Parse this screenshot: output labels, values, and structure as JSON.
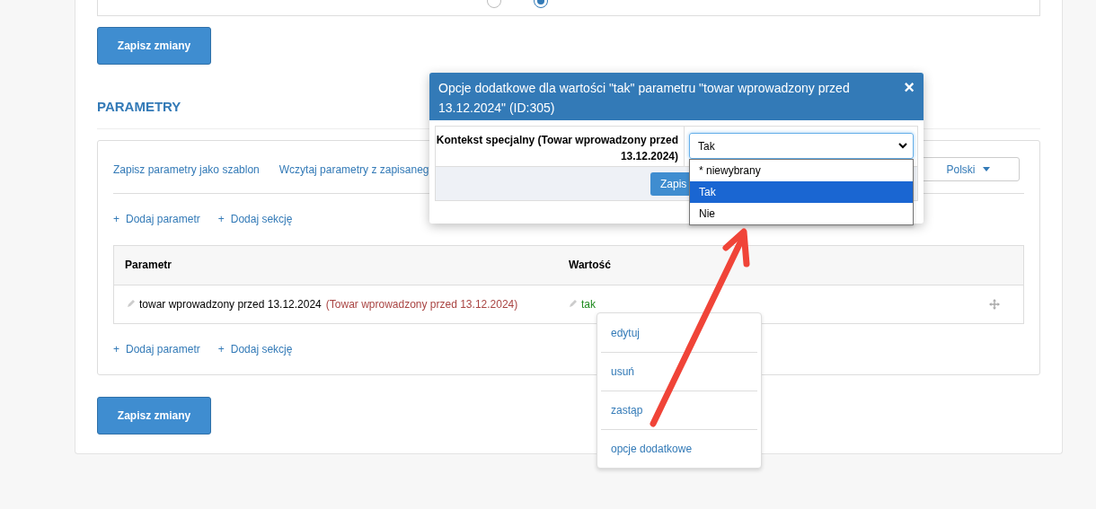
{
  "top_radios": [
    {
      "selected": false
    },
    {
      "selected": true
    }
  ],
  "save_button_top": "Zapisz zmiany",
  "section_title": "PARAMETRY",
  "toolbar_links": [
    "Zapisz parametry jako szablon",
    "Wczytaj parametry z zapisaneg"
  ],
  "language_button": "Polski",
  "add_links_top": [
    {
      "icon": "+",
      "label": "Dodaj parametr"
    },
    {
      "icon": "+",
      "label": "Dodaj sekcję"
    }
  ],
  "table": {
    "columns": [
      "Parametr",
      "Wartość"
    ],
    "rows": [
      {
        "name": "towar wprowadzony przed 13.12.2024",
        "context": "(Towar wprowadzony przed 13.12.2024)",
        "value": "tak"
      }
    ]
  },
  "add_links_bottom": [
    {
      "icon": "+",
      "label": "Dodaj parametr"
    },
    {
      "icon": "+",
      "label": "Dodaj sekcję"
    }
  ],
  "save_button_bottom": "Zapisz zmiany",
  "context_menu": [
    "edytuj",
    "usuń",
    "zastąp",
    "opcje dodatkowe"
  ],
  "modal": {
    "title": "Opcje dodatkowe dla wartości \"tak\" parametru \"towar wprowadzony przed 13.12.2024\" (ID:305)",
    "close": "×",
    "field_label": "Kontekst specjalny (Towar wprowadzony przed 13.12.2024)",
    "select_value": "Tak",
    "save_button": "Zapis",
    "options": [
      {
        "label": "* niewybrany",
        "selected": false
      },
      {
        "label": "Tak",
        "selected": true
      },
      {
        "label": "Nie",
        "selected": false
      }
    ]
  }
}
